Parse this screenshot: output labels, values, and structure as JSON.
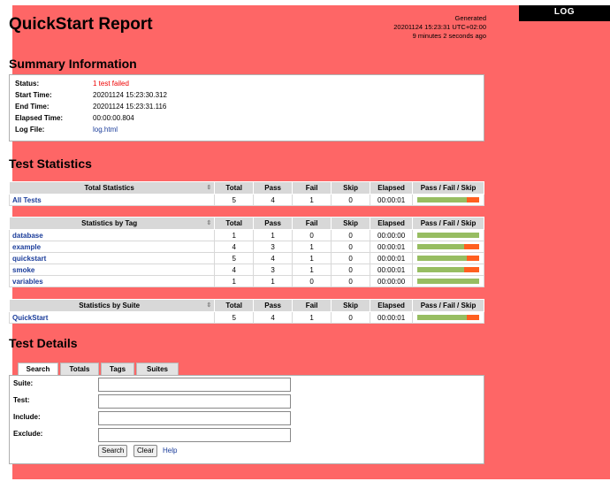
{
  "log_button": "LOG",
  "header": {
    "title": "QuickStart Report",
    "generated_label": "Generated",
    "generated_time": "20201124 15:23:31 UTC+02:00",
    "generated_ago": "9 minutes 2 seconds ago"
  },
  "summary": {
    "heading": "Summary Information",
    "status_label": "Status:",
    "status_value": "1 test failed",
    "start_label": "Start Time:",
    "start_value": "20201124 15:23:30.312",
    "end_label": "End Time:",
    "end_value": "20201124 15:23:31.116",
    "elapsed_label": "Elapsed Time:",
    "elapsed_value": "00:00:00.804",
    "log_label": "Log File:",
    "log_value": "log.html"
  },
  "statistics": {
    "heading": "Test Statistics",
    "columns": [
      "Total",
      "Pass",
      "Fail",
      "Skip",
      "Elapsed",
      "Pass / Fail / Skip"
    ],
    "total": {
      "title": "Total Statistics",
      "rows": [
        {
          "name": "All Tests",
          "total": "5",
          "pass": "4",
          "fail": "1",
          "skip": "0",
          "elapsed": "00:00:01",
          "pass_frac": 0.8,
          "fail_frac": 0.2
        }
      ]
    },
    "tag": {
      "title": "Statistics by Tag",
      "rows": [
        {
          "name": "database",
          "total": "1",
          "pass": "1",
          "fail": "0",
          "skip": "0",
          "elapsed": "00:00:00",
          "pass_frac": 1,
          "fail_frac": 0
        },
        {
          "name": "example",
          "total": "4",
          "pass": "3",
          "fail": "1",
          "skip": "0",
          "elapsed": "00:00:01",
          "pass_frac": 0.75,
          "fail_frac": 0.25
        },
        {
          "name": "quickstart",
          "total": "5",
          "pass": "4",
          "fail": "1",
          "skip": "0",
          "elapsed": "00:00:01",
          "pass_frac": 0.8,
          "fail_frac": 0.2
        },
        {
          "name": "smoke",
          "total": "4",
          "pass": "3",
          "fail": "1",
          "skip": "0",
          "elapsed": "00:00:01",
          "pass_frac": 0.75,
          "fail_frac": 0.25
        },
        {
          "name": "variables",
          "total": "1",
          "pass": "1",
          "fail": "0",
          "skip": "0",
          "elapsed": "00:00:00",
          "pass_frac": 1,
          "fail_frac": 0
        }
      ]
    },
    "suite": {
      "title": "Statistics by Suite",
      "rows": [
        {
          "name": "QuickStart",
          "total": "5",
          "pass": "4",
          "fail": "1",
          "skip": "0",
          "elapsed": "00:00:01",
          "pass_frac": 0.8,
          "fail_frac": 0.2
        }
      ]
    }
  },
  "details": {
    "heading": "Test Details",
    "tabs": [
      "Search",
      "Totals",
      "Tags",
      "Suites"
    ],
    "active_tab": "Search",
    "fields": [
      {
        "label": "Suite:",
        "value": ""
      },
      {
        "label": "Test:",
        "value": ""
      },
      {
        "label": "Include:",
        "value": ""
      },
      {
        "label": "Exclude:",
        "value": ""
      }
    ],
    "search_button": "Search",
    "clear_button": "Clear",
    "help_link": "Help"
  },
  "colors": {
    "background": "#fe6666",
    "pass": "#97bd61",
    "fail": "#ff5f1f",
    "link": "#1a3c9a"
  }
}
